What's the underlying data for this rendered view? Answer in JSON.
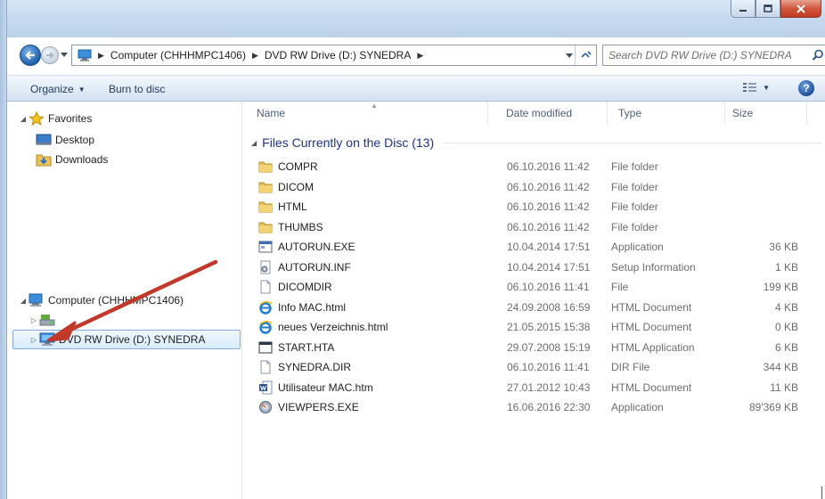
{
  "window": {
    "buttons": [
      "minimize",
      "maximize",
      "close"
    ]
  },
  "address": {
    "breadcrumbs": [
      "Computer (CHHHMPC1406)",
      "DVD RW Drive (D:) SYNEDRA"
    ],
    "icon": "computer-icon"
  },
  "search": {
    "placeholder": "Search DVD RW Drive (D:) SYNEDRA"
  },
  "toolbar": {
    "organize_label": "Organize",
    "burn_label": "Burn to disc"
  },
  "navpane": {
    "favorites_label": "Favorites",
    "desktop_label": "Desktop",
    "downloads_label": "Downloads",
    "computer_label": "Computer (CHHHMPC1406)",
    "drive_label": "DVD RW Drive (D:) SYNEDRA"
  },
  "columns": {
    "name": "Name",
    "date": "Date modified",
    "type": "Type",
    "size": "Size"
  },
  "group": {
    "label": "Files Currently on the Disc (13)"
  },
  "files": [
    {
      "name": "COMPR",
      "date": "06.10.2016 11:42",
      "type": "File folder",
      "size": "",
      "icon": "folder"
    },
    {
      "name": "DICOM",
      "date": "06.10.2016 11:42",
      "type": "File folder",
      "size": "",
      "icon": "folder"
    },
    {
      "name": "HTML",
      "date": "06.10.2016 11:42",
      "type": "File folder",
      "size": "",
      "icon": "folder"
    },
    {
      "name": "THUMBS",
      "date": "06.10.2016 11:42",
      "type": "File folder",
      "size": "",
      "icon": "folder"
    },
    {
      "name": "AUTORUN.EXE",
      "date": "10.04.2014 17:51",
      "type": "Application",
      "size": "36 KB",
      "icon": "exe"
    },
    {
      "name": "AUTORUN.INF",
      "date": "10.04.2014 17:51",
      "type": "Setup Information",
      "size": "1 KB",
      "icon": "inf"
    },
    {
      "name": "DICOMDIR",
      "date": "06.10.2016 11:41",
      "type": "File",
      "size": "199 KB",
      "icon": "file"
    },
    {
      "name": "Info MAC.html",
      "date": "24.09.2008 16:59",
      "type": "HTML Document",
      "size": "4 KB",
      "icon": "ie"
    },
    {
      "name": "neues Verzeichnis.html",
      "date": "21.05.2015 15:38",
      "type": "HTML Document",
      "size": "0 KB",
      "icon": "ie"
    },
    {
      "name": "START.HTA",
      "date": "29.07.2008 15:19",
      "type": "HTML Application",
      "size": "6 KB",
      "icon": "hta"
    },
    {
      "name": "SYNEDRA.DIR",
      "date": "06.10.2016 11:41",
      "type": "DIR File",
      "size": "344 KB",
      "icon": "file"
    },
    {
      "name": "Utilisateur MAC.htm",
      "date": "27.01.2012 10:43",
      "type": "HTML Document",
      "size": "11 KB",
      "icon": "word"
    },
    {
      "name": "VIEWPERS.EXE",
      "date": "16.06.2016 22:30",
      "type": "Application",
      "size": "89'369 KB",
      "icon": "viewer"
    }
  ],
  "colors": {
    "accent": "#1e3287",
    "selection_border": "#84acdd",
    "arrow": "#c0392b"
  }
}
